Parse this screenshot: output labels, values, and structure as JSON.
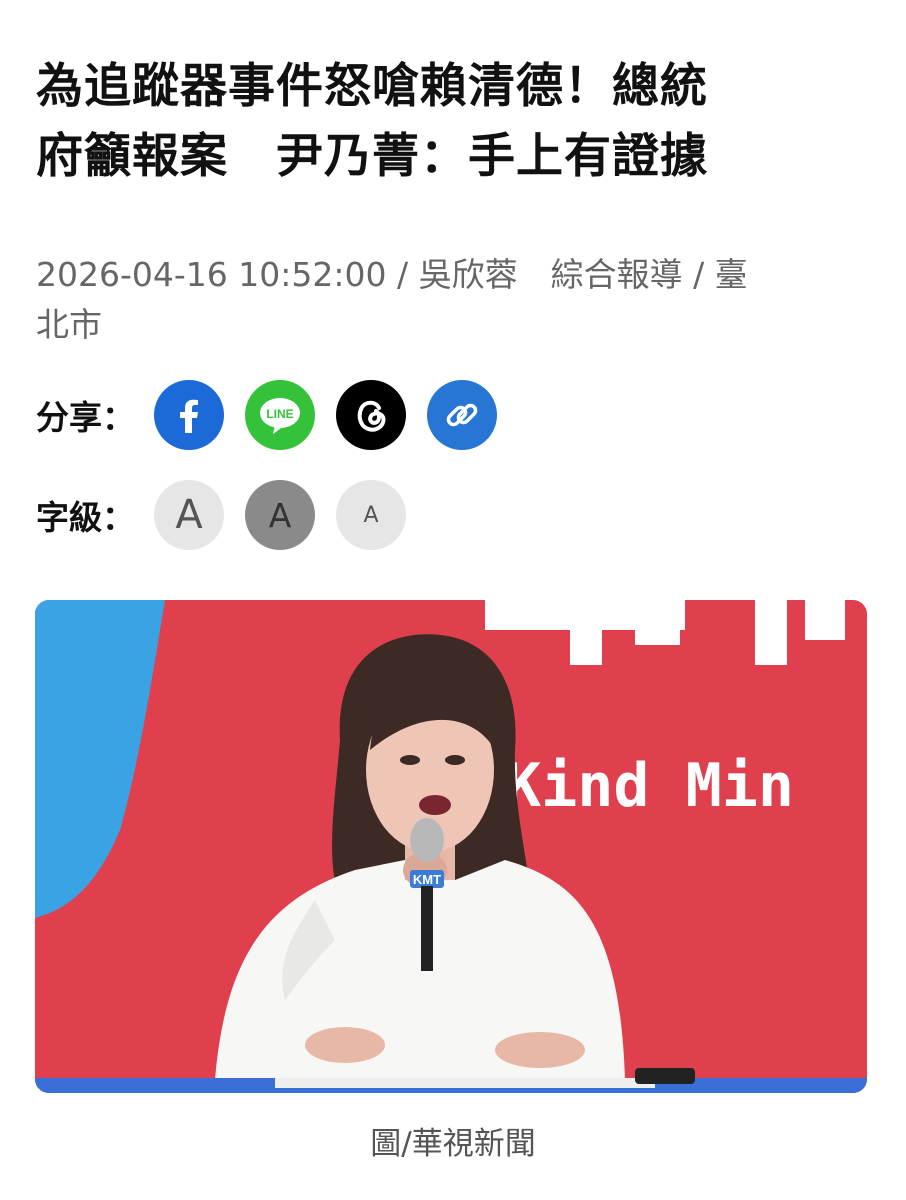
{
  "article": {
    "title_line1": "為追蹤器事件怒嗆賴清德！總統",
    "title_line2": "府籲報案　尹乃菁：手上有證據",
    "meta_line1": "2026-04-16 10:52:00 / 吳欣蓉　綜合報導 / 臺",
    "meta_line2": "北市"
  },
  "share": {
    "label": "分享：",
    "buttons": [
      {
        "name": "facebook",
        "icon": "facebook-icon",
        "color": "#1b6ad8"
      },
      {
        "name": "line",
        "icon": "line-icon",
        "icon_text": "LINE",
        "color": "#35c23b"
      },
      {
        "name": "threads",
        "icon": "threads-icon",
        "color": "#000000"
      },
      {
        "name": "copy-link",
        "icon": "link-icon",
        "color": "#2876d3"
      }
    ]
  },
  "font_size": {
    "label": "字級：",
    "options": [
      {
        "size": "large",
        "glyph": "A"
      },
      {
        "size": "medium",
        "glyph": "A",
        "selected": true
      },
      {
        "size": "small",
        "glyph": "A"
      }
    ]
  },
  "photo": {
    "backdrop_text": "Kind Min",
    "mic_flag": "KMT"
  },
  "caption": "圖/華視新聞"
}
